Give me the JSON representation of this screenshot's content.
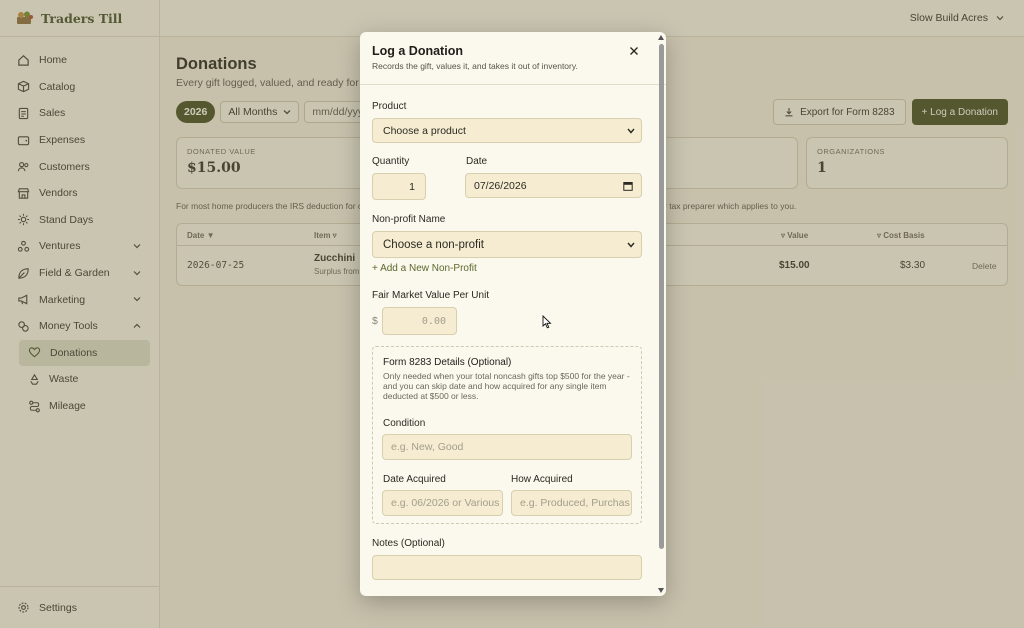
{
  "brand": {
    "name": "Traders Till"
  },
  "nav": {
    "items": [
      {
        "label": "Home",
        "icon": "home-icon"
      },
      {
        "label": "Catalog",
        "icon": "box-icon"
      },
      {
        "label": "Sales",
        "icon": "receipt-icon"
      },
      {
        "label": "Expenses",
        "icon": "wallet-icon"
      },
      {
        "label": "Customers",
        "icon": "users-icon"
      },
      {
        "label": "Vendors",
        "icon": "store-icon"
      },
      {
        "label": "Stand Days",
        "icon": "sun-icon"
      },
      {
        "label": "Ventures",
        "icon": "ventures-icon"
      },
      {
        "label": "Field & Garden",
        "icon": "leaf-icon"
      },
      {
        "label": "Marketing",
        "icon": "megaphone-icon"
      },
      {
        "label": "Money Tools",
        "icon": "coins-icon"
      }
    ],
    "money_sub": [
      {
        "label": "Donations",
        "icon": "heart-hand-icon"
      },
      {
        "label": "Waste",
        "icon": "recycle-icon"
      },
      {
        "label": "Mileage",
        "icon": "route-icon"
      }
    ],
    "settings": "Settings"
  },
  "topbar": {
    "account": "Slow Build Acres"
  },
  "page": {
    "title": "Donations",
    "subtitle": "Every gift logged, valued, and ready for ta",
    "year": "2026",
    "months": "All Months",
    "date_placeholder": "mm/dd/yyy",
    "export_label": "Export for Form 8283",
    "log_label": "+ Log a Donation",
    "cards": [
      {
        "label": "DONATED VALUE",
        "value": "$15.00"
      },
      {
        "label": "ORGANIZATIONS",
        "value": "1"
      }
    ],
    "note_left": "For most home producers the IRS deduction for c",
    "note_right": "r tax preparer which applies to you.",
    "table": {
      "headers": {
        "date": "Date ▼",
        "item": "Item ▿",
        "value": "▿ Value",
        "cost": "▿ Cost Basis"
      },
      "rows": [
        {
          "date": "2026-07-25",
          "item": "Zucchini",
          "item_sub": "Surplus from",
          "value": "$15.00",
          "cost": "$3.30",
          "delete": "Delete"
        }
      ]
    }
  },
  "modal": {
    "title": "Log a Donation",
    "subtitle": "Records the gift, values it, and takes it out of inventory.",
    "product_label": "Product",
    "product_value": "Choose a product",
    "quantity_label": "Quantity",
    "quantity_value": "1",
    "date_label": "Date",
    "date_value": "07/26/2026",
    "nonprofit_label": "Non-profit Name",
    "nonprofit_value": "Choose a non-profit",
    "add_nonprofit": "+ Add a New Non-Profit",
    "fmv_label": "Fair Market Value Per Unit",
    "currency": "$",
    "fmv_placeholder": "0.00",
    "form8283": {
      "title": "Form 8283 Details (Optional)",
      "desc": "Only needed when your total noncash gifts top $500 for the year - and you can skip date and how acquired for any single item deducted at $500 or less.",
      "condition_label": "Condition",
      "condition_placeholder": "e.g. New, Good",
      "date_acq_label": "Date Acquired",
      "date_acq_placeholder": "e.g. 06/2026 or Various",
      "how_acq_label": "How Acquired",
      "how_acq_placeholder": "e.g. Produced, Purchas"
    },
    "notes_label": "Notes (Optional)"
  }
}
